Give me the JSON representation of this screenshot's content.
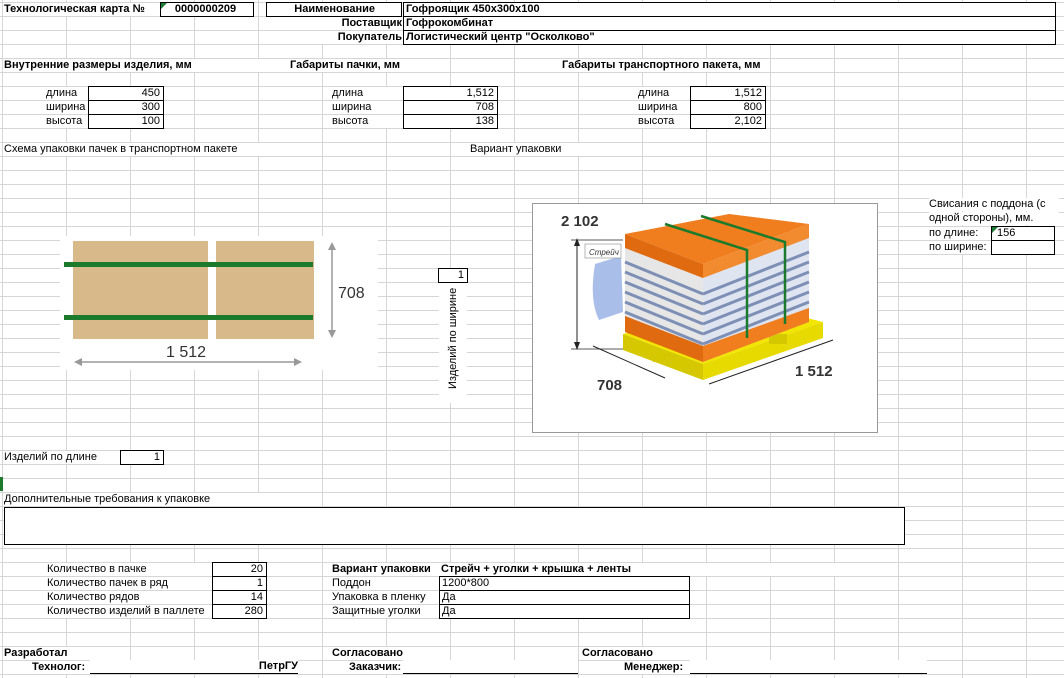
{
  "header": {
    "card_label": "Технологическая карта №",
    "card_number": "0000000209",
    "name_label": "Наименование",
    "name_value": "Гофроящик 450х300х100",
    "supplier_label": "Поставщик",
    "supplier_value": "Гофрокомбинат",
    "buyer_label": "Покупатель",
    "buyer_value": "Логистический центр \"Осколково\""
  },
  "dims": {
    "inner_title": "Внутренние размеры изделия, мм",
    "pack_title": "Габариты пачки, мм",
    "transport_title": "Габариты транспортного пакета, мм",
    "length_label": "длина",
    "width_label": "ширина",
    "height_label": "высота",
    "inner": {
      "length": "450",
      "width": "300",
      "height": "100"
    },
    "pack": {
      "length": "1,512",
      "width": "708",
      "height": "138"
    },
    "transport": {
      "length": "1,512",
      "width": "800",
      "height": "2,102"
    }
  },
  "scheme": {
    "title": "Схема упаковки пачек в транспортном пакете",
    "dim_width": "708",
    "dim_length": "1 512",
    "items_by_width_label": "Изделий по ширине",
    "items_by_width_value": "1",
    "items_by_length_label": "Изделий по длине",
    "items_by_length_value": "1"
  },
  "variant": {
    "title": "Вариант упаковки",
    "dim_height": "2 102",
    "dim_width": "708",
    "dim_length": "1 512",
    "stretch_label": "Стрейч"
  },
  "overhang": {
    "title_line1": "Свисания с поддона (с",
    "title_line2": "одной стороны), мм.",
    "by_length_label": "по длине:",
    "by_length_value": "156",
    "by_width_label": "по ширине:",
    "by_width_value": ""
  },
  "extra": {
    "title": "Дополнительные требования к упаковке",
    "value": ""
  },
  "quantities": {
    "per_pack_label": "Количество в пачке",
    "per_pack_value": "20",
    "packs_per_row_label": "Количество пачек в ряд",
    "packs_per_row_value": "1",
    "rows_label": "Количество рядов",
    "rows_value": "14",
    "per_pallet_label": "Количество изделий в паллете",
    "per_pallet_value": "280"
  },
  "packing": {
    "variant_label": "Вариант упаковки",
    "variant_value": "Стрейч + уголки + крышка + ленты",
    "pallet_label": "Поддон",
    "pallet_value": "1200*800",
    "film_label": "Упаковка в пленку",
    "film_value": "Да",
    "corners_label": "Защитные уголки",
    "corners_value": "Да"
  },
  "signatures": {
    "developed_label": "Разработал",
    "technologist_label": "Технолог:",
    "technologist_value": "ПетрГУ",
    "agreed1_label": "Согласовано",
    "customer_label": "Заказчик:",
    "agreed2_label": "Согласовано",
    "manager_label": "Менеджер:"
  },
  "colors": {
    "cardboard": "#d8b98a",
    "strap": "#1c7a2c",
    "lid": "#f07d1e",
    "pallet": "#f2e600",
    "film": "#9ab4e6"
  }
}
